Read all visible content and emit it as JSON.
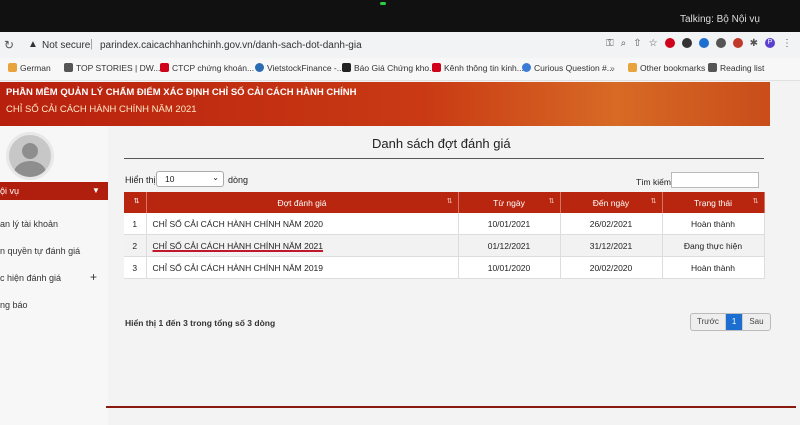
{
  "meeting": {
    "talking": "Talking: Bộ Nội vụ"
  },
  "browser": {
    "security": "Not secure",
    "url": "parindex.caicachhanhchinh.gov.vn/danh-sach-dot-danh-gia",
    "profile_initial": "P"
  },
  "bookmarks": [
    {
      "label": "German",
      "color": "#e8a33d"
    },
    {
      "label": "TOP STORIES | DW...",
      "color": "#555555"
    },
    {
      "label": "CTCP chứng khoán...",
      "color": "#d0021b"
    },
    {
      "label": "VietstockFinance -...",
      "color": "#2b6cb0"
    },
    {
      "label": "Báo Giá Chứng kho...",
      "color": "#222222"
    },
    {
      "label": "Kênh thông tin kinh...",
      "color": "#d0021b"
    },
    {
      "label": "Curious Question #...",
      "color": "#3a7bd5"
    },
    {
      "label": "Other bookmarks",
      "color": "#e8a33d"
    },
    {
      "label": "Reading list",
      "color": "#555555"
    }
  ],
  "banner": {
    "title": "PHẦN MỀM QUẢN LÝ CHẤM ĐIỂM XÁC ĐỊNH CHỈ SỐ CẢI CÁCH HÀNH CHÍNH",
    "subtitle": "CHỈ SỐ CẢI CÁCH HÀNH CHÍNH NĂM 2021"
  },
  "sidebar": {
    "user": "ội vụ",
    "items": [
      {
        "label": "an lý tài khoản"
      },
      {
        "label": "n quyền tự đánh giá"
      },
      {
        "label": "c hiện đánh giá",
        "plus": "+"
      },
      {
        "label": "ng báo"
      }
    ]
  },
  "main": {
    "title": "Danh sách đợt đánh giá",
    "show_label": "Hiển thị",
    "page_size": "10",
    "rows_label": "dòng",
    "search_label": "Tìm kiếm",
    "search_value": "",
    "columns": [
      "",
      "Đợt đánh giá",
      "Từ ngày",
      "Đến ngày",
      "Trạng thái"
    ],
    "rows": [
      {
        "no": "1",
        "name": "CHỈ SỐ CẢI CÁCH HÀNH CHÍNH NĂM 2020",
        "from": "10/01/2021",
        "to": "26/02/2021",
        "status": "Hoàn thành"
      },
      {
        "no": "2",
        "name": "CHỈ SỐ CẢI CÁCH HÀNH CHÍNH NĂM 2021",
        "from": "01/12/2021",
        "to": "31/12/2021",
        "status": "Đang thực hiện"
      },
      {
        "no": "3",
        "name": "CHỈ SỐ CẢI CÁCH HÀNH CHÍNH NĂM 2019",
        "from": "10/01/2020",
        "to": "20/02/2020",
        "status": "Hoàn thành"
      }
    ],
    "info": "Hiển thị 1 đến 3 trong tổng số 3 dòng",
    "pager": {
      "prev": "Trước",
      "current": "1",
      "next": "Sau"
    }
  }
}
